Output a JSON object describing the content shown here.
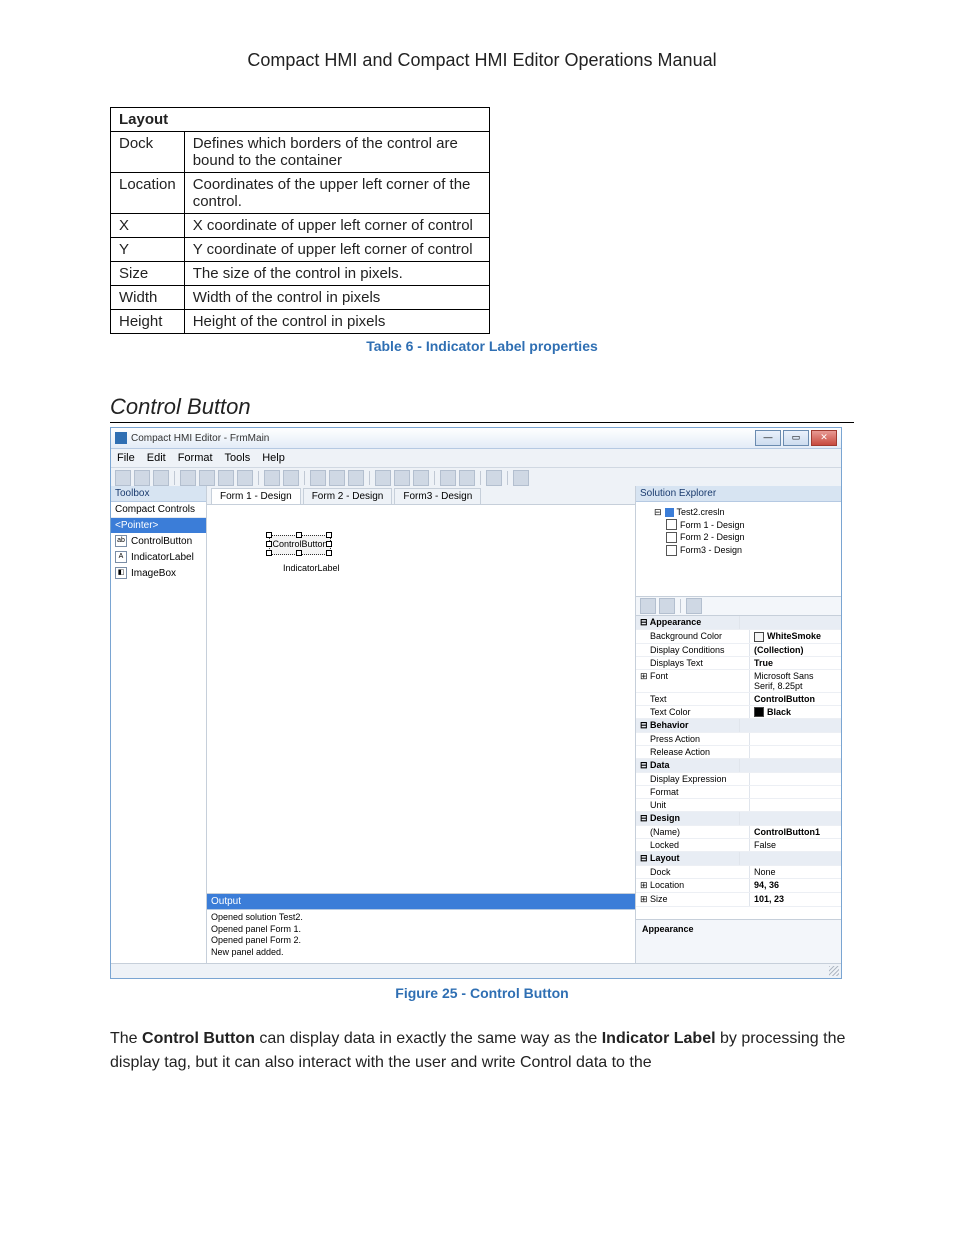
{
  "doc_title": "Compact HMI and Compact HMI Editor Operations Manual",
  "table": {
    "header": "Layout",
    "rows": [
      {
        "k": "Dock",
        "v": "Defines which borders of the control are bound to the container"
      },
      {
        "k": "Location",
        "v": "Coordinates of the upper left corner of the control."
      },
      {
        "k": "X",
        "v": "X coordinate of upper left corner of control"
      },
      {
        "k": "Y",
        "v": "Y coordinate of upper left corner of control"
      },
      {
        "k": "Size",
        "v": "The size of the control in pixels."
      },
      {
        "k": "Width",
        "v": "Width of the control in pixels"
      },
      {
        "k": "Height",
        "v": "Height of the control in pixels"
      }
    ],
    "caption": "Table 6 - Indicator Label properties"
  },
  "section_heading": "Control Button",
  "figure_caption": "Figure 25 - Control Button",
  "body_para_prefix": "The ",
  "body_para_bold1": "Control Button",
  "body_para_mid": " can display data in exactly the same way as the ",
  "body_para_bold2": "Indicator Label",
  "body_para_suffix": " by processing the display tag, but it can also interact with the user and write Control data to the",
  "shot": {
    "title": "Compact HMI Editor - FrmMain",
    "menu": [
      "File",
      "Edit",
      "Format",
      "Tools",
      "Help"
    ],
    "toolbox": {
      "title": "Toolbox",
      "group": "Compact Controls",
      "pointer": "<Pointer>",
      "items": [
        "ControlButton",
        "IndicatorLabel",
        "ImageBox"
      ]
    },
    "tabs": [
      "Form 1 - Design",
      "Form 2 - Design",
      "Form3 - Design"
    ],
    "active_tab": 0,
    "canvas": {
      "control_label": "ControlButton",
      "indicator_label": "IndicatorLabel"
    },
    "output": {
      "title": "Output",
      "lines": [
        "Opened solution Test2.",
        "Opened panel Form 1.",
        "Opened panel Form 2.",
        "New panel added."
      ]
    },
    "explorer": {
      "title": "Solution Explorer",
      "project": "Test2.cresln",
      "forms": [
        "Form 1 - Design",
        "Form 2 - Design",
        "Form3 - Design"
      ]
    },
    "props": {
      "categories": [
        {
          "name": "Appearance",
          "rows": [
            {
              "k": "Background Color",
              "v": "WhiteSmoke",
              "swatch": "#f5f5f5",
              "bold": true
            },
            {
              "k": "Display Conditions",
              "v": "(Collection)",
              "bold": true
            },
            {
              "k": "Displays Text",
              "v": "True",
              "bold": true
            },
            {
              "k": "Font",
              "v": "Microsoft Sans Serif, 8.25pt",
              "expand": true
            },
            {
              "k": "Text",
              "v": "ControlButton",
              "bold": true
            },
            {
              "k": "Text Color",
              "v": "Black",
              "swatch": "#000000",
              "bold": true
            }
          ]
        },
        {
          "name": "Behavior",
          "rows": [
            {
              "k": "Press Action",
              "v": ""
            },
            {
              "k": "Release Action",
              "v": ""
            }
          ]
        },
        {
          "name": "Data",
          "rows": [
            {
              "k": "Display Expression",
              "v": ""
            },
            {
              "k": "Format",
              "v": ""
            },
            {
              "k": "Unit",
              "v": ""
            }
          ]
        },
        {
          "name": "Design",
          "rows": [
            {
              "k": "(Name)",
              "v": "ControlButton1",
              "bold": true
            },
            {
              "k": "Locked",
              "v": "False"
            }
          ]
        },
        {
          "name": "Layout",
          "rows": [
            {
              "k": "Dock",
              "v": "None"
            },
            {
              "k": "Location",
              "v": "94, 36",
              "bold": true,
              "expand": true
            },
            {
              "k": "Size",
              "v": "101, 23",
              "bold": true,
              "expand": true
            }
          ]
        }
      ],
      "desc": "Appearance"
    }
  }
}
